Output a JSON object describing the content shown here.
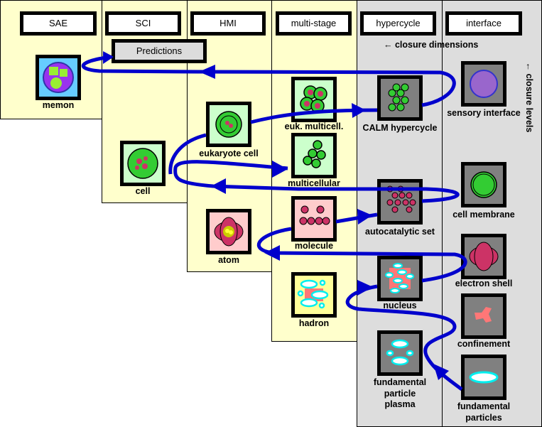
{
  "columns": [
    {
      "label": "SAE"
    },
    {
      "label": "SCI"
    },
    {
      "label": "HMI"
    },
    {
      "label": "multi-stage"
    },
    {
      "label": "hypercycle"
    },
    {
      "label": "interface"
    }
  ],
  "predictions": "Predictions",
  "notes": {
    "closure_dimensions": "← closure dimensions",
    "closure_levels": "← closure levels"
  },
  "nodes": {
    "memon": "memon",
    "cell": "cell",
    "eukaryote_cell": "eukaryote cell",
    "atom": "atom",
    "euk_multicell": "euk. multicell.",
    "multicellular": "multicellular",
    "molecule": "molecule",
    "hadron": "hadron",
    "calm_hypercycle": "CALM hypercycle",
    "autocatalytic_set": "autocatalytic set",
    "nucleus": "nucleus",
    "fpp_1": "fundamental",
    "fpp_2": "particle",
    "fpp_3": "plasma",
    "sensory_interface": "sensory interface",
    "cell_membrane": "cell membrane",
    "electron_shell": "electron shell",
    "confinement": "confinement",
    "fp_1": "fundamental",
    "fp_2": "particles"
  },
  "colors": {
    "arrow": "#0000cc",
    "stage_panel": "#ffffcc",
    "closure_panel": "#dddddd"
  }
}
